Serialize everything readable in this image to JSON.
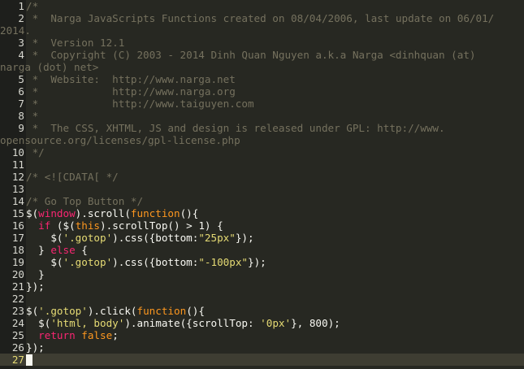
{
  "editor": {
    "lines": [
      {
        "n": "1",
        "segments": [
          {
            "t": "/*",
            "c": "cm"
          }
        ]
      },
      {
        "n": "2",
        "tall": true,
        "segments": [
          {
            "t": " *  Narga JavaScripts Functions created on 08/04/2006, last update on 06/01/",
            "c": "cm"
          }
        ],
        "tail": [
          {
            "t": "2014.",
            "c": "cm"
          }
        ]
      },
      {
        "n": "3",
        "segments": [
          {
            "t": " *  Version 12.1",
            "c": "cm"
          }
        ]
      },
      {
        "n": "4",
        "tall": true,
        "segments": [
          {
            "t": " *  Copyright (C) 2003 - 2014 Dinh Quan Nguyen a.k.a Narga <dinhquan (at)",
            "c": "cm"
          }
        ],
        "tail": [
          {
            "t": "narga (dot) net>",
            "c": "cm"
          }
        ]
      },
      {
        "n": "5",
        "segments": [
          {
            "t": " *  Website:  http://www.narga.net",
            "c": "cm"
          }
        ]
      },
      {
        "n": "6",
        "segments": [
          {
            "t": " *            http://www.narga.org",
            "c": "cm"
          }
        ]
      },
      {
        "n": "7",
        "segments": [
          {
            "t": " *            http://www.taiguyen.com",
            "c": "cm"
          }
        ]
      },
      {
        "n": "8",
        "segments": [
          {
            "t": " *",
            "c": "cm"
          }
        ]
      },
      {
        "n": "9",
        "tall": true,
        "segments": [
          {
            "t": " *  The CSS, XHTML, JS and design is released under GPL: http://www.",
            "c": "cm"
          }
        ],
        "tail": [
          {
            "t": "opensource.org/licenses/gpl-license.php",
            "c": "cm"
          }
        ]
      },
      {
        "n": "10",
        "segments": [
          {
            "t": " */",
            "c": "cm"
          }
        ]
      },
      {
        "n": "11",
        "segments": []
      },
      {
        "n": "12",
        "segments": [
          {
            "t": "/* <![CDATA[ */",
            "c": "cm"
          }
        ]
      },
      {
        "n": "13",
        "segments": []
      },
      {
        "n": "14",
        "segments": [
          {
            "t": "/* Go Top Button */",
            "c": "cm"
          }
        ]
      },
      {
        "n": "15",
        "segments": [
          {
            "t": "$(",
            "c": "pl"
          },
          {
            "t": "window",
            "c": "kw"
          },
          {
            "t": ").scroll(",
            "c": "pl"
          },
          {
            "t": "function",
            "c": "fn"
          },
          {
            "t": "(){",
            "c": "pl"
          }
        ]
      },
      {
        "n": "16",
        "segments": [
          {
            "t": "  ",
            "c": "pl"
          },
          {
            "t": "if",
            "c": "kw"
          },
          {
            "t": " ($(",
            "c": "pl"
          },
          {
            "t": "this",
            "c": "fn"
          },
          {
            "t": ").scrollTop() > 1) {",
            "c": "pl"
          }
        ]
      },
      {
        "n": "17",
        "segments": [
          {
            "t": "    $(",
            "c": "pl"
          },
          {
            "t": "'.gotop'",
            "c": "str"
          },
          {
            "t": ").css({bottom:",
            "c": "pl"
          },
          {
            "t": "\"25px\"",
            "c": "str"
          },
          {
            "t": "});",
            "c": "pl"
          }
        ]
      },
      {
        "n": "18",
        "segments": [
          {
            "t": "  } ",
            "c": "pl"
          },
          {
            "t": "else",
            "c": "kw"
          },
          {
            "t": " {",
            "c": "pl"
          }
        ]
      },
      {
        "n": "19",
        "segments": [
          {
            "t": "    $(",
            "c": "pl"
          },
          {
            "t": "'.gotop'",
            "c": "str"
          },
          {
            "t": ").css({bottom:",
            "c": "pl"
          },
          {
            "t": "\"-100px\"",
            "c": "str"
          },
          {
            "t": "});",
            "c": "pl"
          }
        ]
      },
      {
        "n": "20",
        "segments": [
          {
            "t": "  }",
            "c": "pl"
          }
        ]
      },
      {
        "n": "21",
        "segments": [
          {
            "t": "});",
            "c": "pl"
          }
        ]
      },
      {
        "n": "22",
        "segments": []
      },
      {
        "n": "23",
        "segments": [
          {
            "t": "$(",
            "c": "pl"
          },
          {
            "t": "'.gotop'",
            "c": "str"
          },
          {
            "t": ").click(",
            "c": "pl"
          },
          {
            "t": "function",
            "c": "fn"
          },
          {
            "t": "(){",
            "c": "pl"
          }
        ]
      },
      {
        "n": "24",
        "segments": [
          {
            "t": "  $(",
            "c": "pl"
          },
          {
            "t": "'html, body'",
            "c": "str"
          },
          {
            "t": ").animate({scrollTop: ",
            "c": "pl"
          },
          {
            "t": "'0px'",
            "c": "str"
          },
          {
            "t": "}, 800);",
            "c": "pl"
          }
        ]
      },
      {
        "n": "25",
        "segments": [
          {
            "t": "  ",
            "c": "pl"
          },
          {
            "t": "return",
            "c": "kw"
          },
          {
            "t": " ",
            "c": "pl"
          },
          {
            "t": "false",
            "c": "fn"
          },
          {
            "t": ";",
            "c": "pl"
          }
        ]
      },
      {
        "n": "26",
        "segments": [
          {
            "t": "});",
            "c": "pl"
          }
        ]
      },
      {
        "n": "27",
        "current": true,
        "segments": []
      }
    ],
    "colors": {
      "background": "#272822",
      "gutter": "#1e1f1c",
      "comment": "#75715e",
      "string": "#e6db74",
      "keyword": "#f92672",
      "function": "#fd971f",
      "current_line": "#3e3d32"
    }
  }
}
